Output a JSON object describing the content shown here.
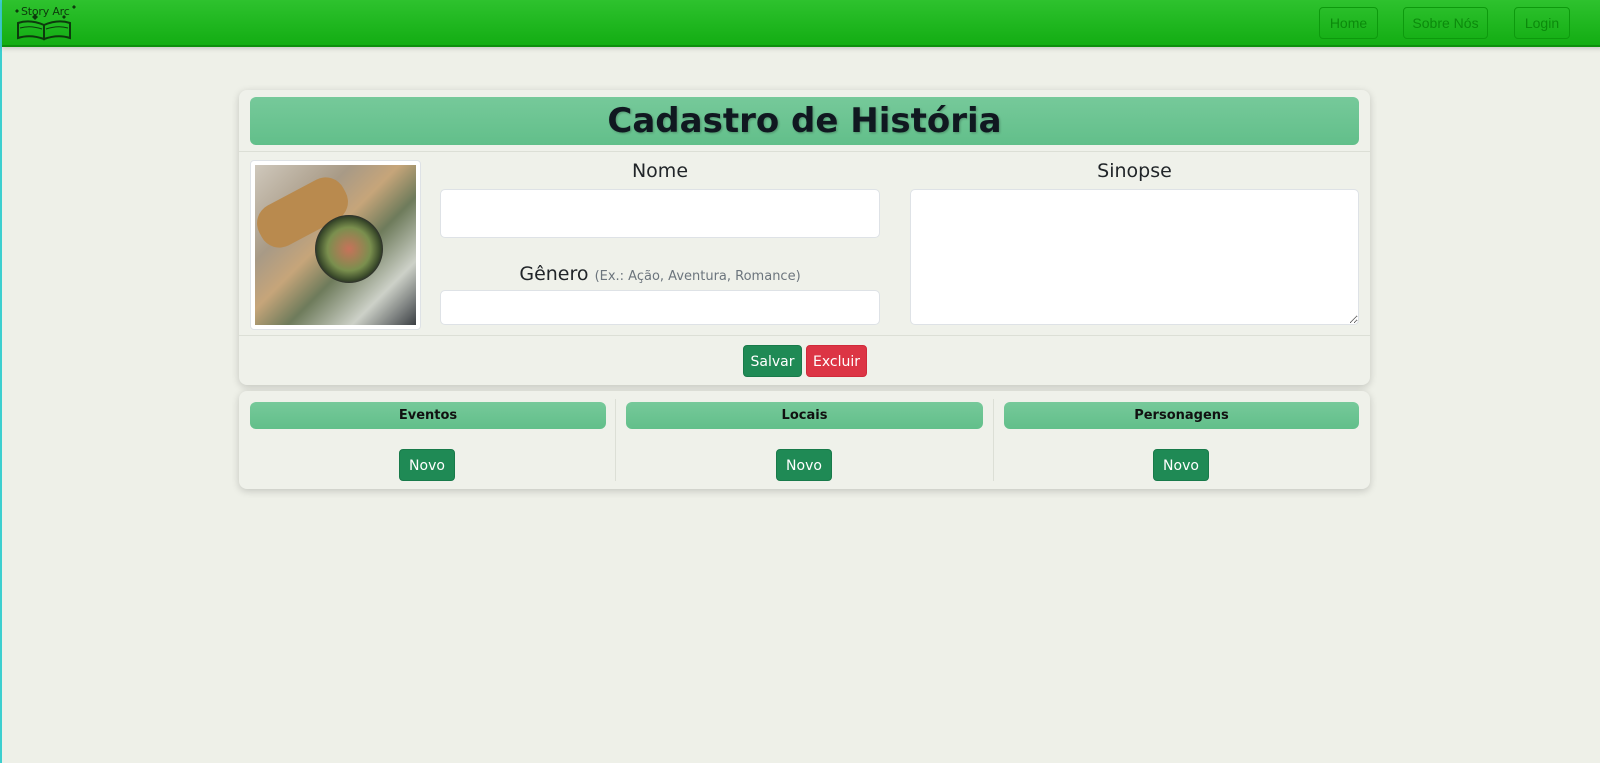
{
  "navbar": {
    "logo_text": "Story Arc",
    "links": [
      "Home",
      "Sobre Nós",
      "Login"
    ]
  },
  "form": {
    "title": "Cadastro de História",
    "nome_label": "Nome",
    "nome_value": "",
    "genero_label": "Gênero",
    "genero_hint": "(Ex.: Ação, Aventura, Romance)",
    "genero_value": "",
    "sinopse_label": "Sinopse",
    "sinopse_value": "",
    "save_label": "Salvar",
    "delete_label": "Excluir"
  },
  "sections": [
    {
      "title": "Eventos",
      "button": "Novo"
    },
    {
      "title": "Locais",
      "button": "Novo"
    },
    {
      "title": "Personagens",
      "button": "Novo"
    }
  ],
  "colors": {
    "navbar": "#1db51d",
    "accent": "#69c391",
    "primary_button": "#1f8a55",
    "danger_button": "#dc3545",
    "background": "#eef0e8"
  }
}
